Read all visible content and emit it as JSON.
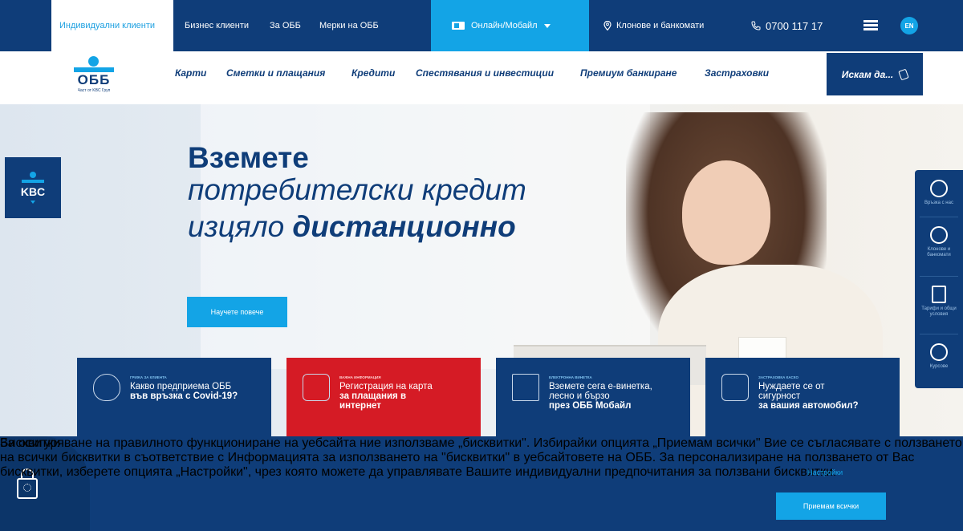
{
  "topbar": {
    "tab_individuals": "Индивидуални клиенти",
    "tab_business": "Бизнес клиенти",
    "tab_about": "За ОББ",
    "tab_measures": "Мерки на ОББ",
    "online_label": "Онлайн/Мобайл",
    "branches_label": "Клонове и банкомати",
    "phone": "0700 117 17",
    "lang": "EN"
  },
  "logo": {
    "name": "ОББ",
    "subtitle": "Част от KBC Груп"
  },
  "nav": {
    "items": [
      "Карти",
      "Сметки и плащания",
      "Кредити",
      "Спестявания и инвестиции",
      "Премиум банкиране",
      "Застраховки"
    ],
    "cta": "Искам да..."
  },
  "kbc": {
    "label": "KBC"
  },
  "hero": {
    "line1": "Вземете",
    "line2": "потребителски кредит",
    "line3a": "изцяло ",
    "line3b": "дистанционно",
    "button": "Научете повече"
  },
  "rail": {
    "items": [
      "Връзка с нас",
      "Клонове и банкомати",
      "Тарифи и общи условия",
      "Курсове"
    ]
  },
  "cards": [
    {
      "caption": "ГРИЖА ЗА КЛИЕНТА",
      "text1": "Какво предприема ОББ",
      "text2": "във връзка с Covid-19?"
    },
    {
      "caption": "ВАЖНА ИНФОРМАЦИЯ",
      "text1": "Регистрация на карта",
      "text2": "за плащания в",
      "text3": "интернет"
    },
    {
      "caption": "ЕЛЕКТРОННА ВИНЕТКА",
      "text1": "Вземете сега e-винетка,",
      "text2": "лесно и бързо",
      "text3": "през ОББ Мобайл"
    },
    {
      "caption": "ЗАСТРАХОВКА КАСКО",
      "text1": "Нуждаете се от",
      "text2": "сигурност",
      "text3": "за вашия автомобил?"
    }
  ],
  "cookie": {
    "title": "Бисквитки",
    "msg_1": "За осигуряване на правилното функциониране на уебсайта ние използваме „бисквитки\". Избирайки опцията „Приемам всички\" Вие се съгласявате с ползването на всички бисквитки в съответствие с ",
    "msg_link": "Информацията за използването на \"бисквитки\" в уебсайтовете на ОББ",
    "msg_2": ". За персонализиране на ползването от Вас бисквитки, изберете опцията „Настройки\", чрез която можете да управлявате Вашите индивидуални предпочитания за ползвани бисквитки.",
    "settings": "Настройки",
    "accept": "Приемам всички"
  }
}
